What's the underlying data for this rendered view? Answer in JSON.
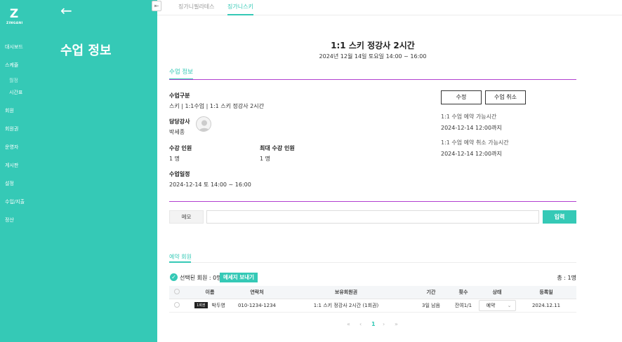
{
  "brand": {
    "logo_mark": "Z",
    "logo_text": "ZINGANI"
  },
  "sidebar": {
    "heading": "수업 정보",
    "back_icon": "←",
    "items": [
      {
        "label": "대시보드"
      },
      {
        "label": "스케쥴"
      },
      {
        "label": "월정"
      },
      {
        "label": "시간표"
      },
      {
        "label": "회원"
      },
      {
        "label": "회원권"
      },
      {
        "label": "운영자"
      },
      {
        "label": "게시판"
      },
      {
        "label": "설정"
      },
      {
        "label": "수입/지출"
      },
      {
        "label": "정산"
      }
    ]
  },
  "collapse_icon": "⇤",
  "tabs": [
    {
      "label": "징가니필라테스"
    },
    {
      "label": "징가니스키"
    }
  ],
  "class_info": {
    "title": "1:1 스키 정강사 2시간",
    "datetime": "2024년 12월 14일 토요일 14:00 ~ 16:00",
    "section_label": "수업 정보",
    "type_label": "수업구분",
    "type_value": "스키 | 1:1수업 | 1:1 스키 정강사 2시간",
    "instructor_label": "담당강사",
    "instructor_value": "박세종",
    "capacity_label": "수강 인원",
    "capacity_value": "1 명",
    "max_capacity_label": "최대 수강 인원",
    "max_capacity_value": "1 명",
    "schedule_label": "수업일정",
    "schedule_value": "2024-12-14  토 14:00 ~ 16:00",
    "edit_button": "수정",
    "cancel_button": "수업 취소",
    "reserve_label": "1:1 수업 예약 가능시간",
    "reserve_value": "2024-12-14 12:00까지",
    "cancel_label": "1:1 수업 예약 취소 가능시간",
    "cancel_value": "2024-12-14 12:00까지"
  },
  "memo": {
    "label": "메모",
    "value": "",
    "placeholder": "",
    "submit": "입력"
  },
  "reservations": {
    "section_label": "예약 회원",
    "selected_text": "선택된 회원 : 0명",
    "send_button": "메세지 보내기",
    "total_text": "총 : 1명",
    "columns": [
      "이름",
      "연락처",
      "보유회원권",
      "기간",
      "횟수",
      "상태",
      "등록일"
    ],
    "rows": [
      {
        "badge": "1회권",
        "name": "박두영",
        "phone": "010-1234-1234",
        "membership": "1:1 스키 정강사 2시간 (1회권)",
        "period": "3일 남음",
        "count": "잔여1/1",
        "status": "예약",
        "registered": "2024.12.11"
      }
    ]
  },
  "pagination": {
    "first": "«",
    "prev": "‹",
    "current": "1",
    "next": "›",
    "last": "»"
  },
  "colors": {
    "accent": "#35c9b6",
    "divider": "#b23fcf"
  }
}
